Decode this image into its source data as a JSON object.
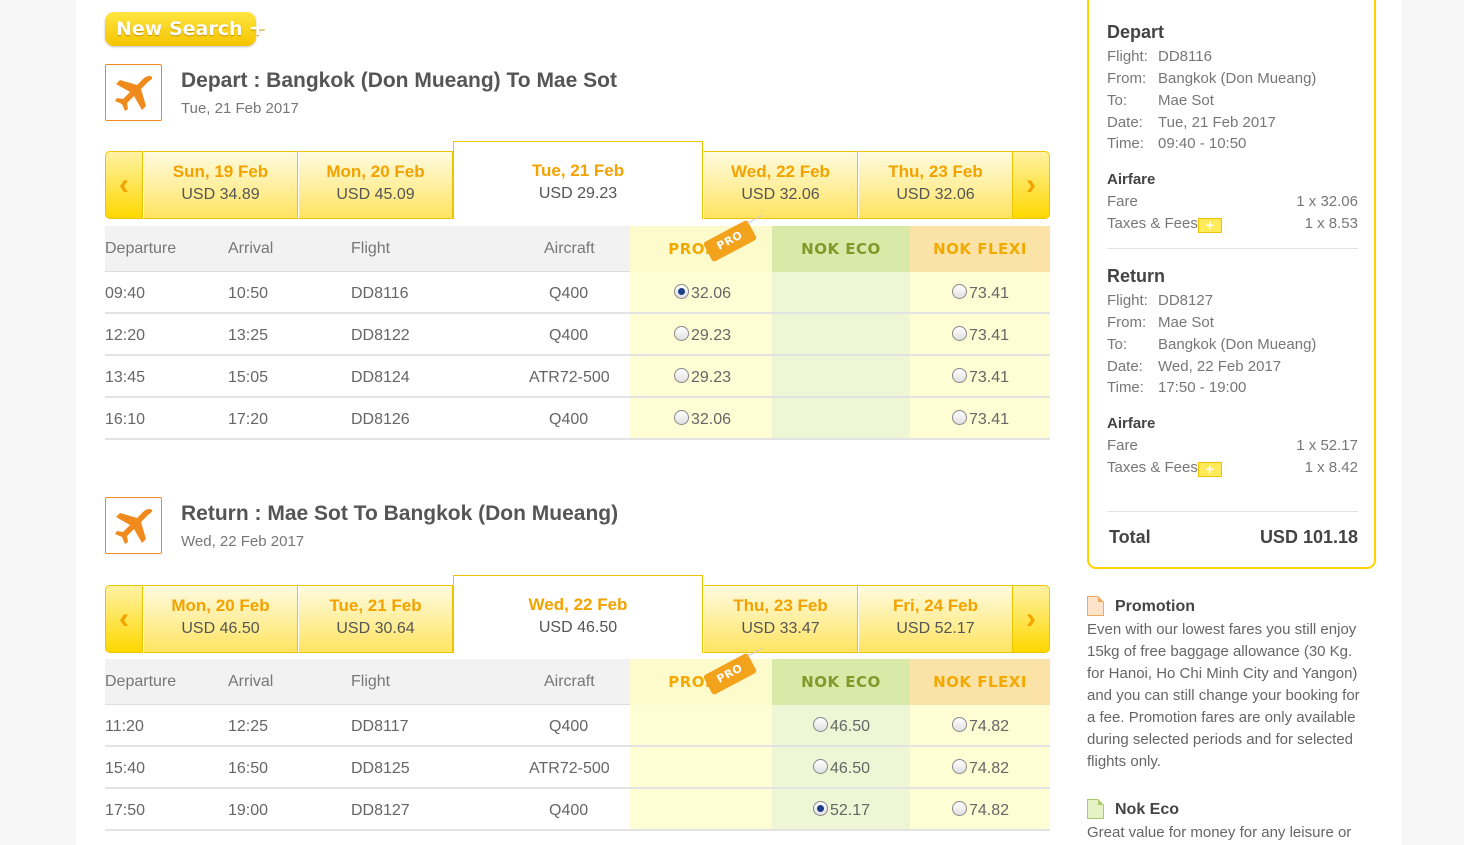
{
  "new_search": {
    "label": "New Search",
    "plus": "+"
  },
  "depart": {
    "title": "Depart :  Bangkok (Don Mueang)  To  Mae Sot",
    "date": "Tue, 21 Feb 2017",
    "dates": [
      {
        "day": "Sun, 19 Feb",
        "price": "USD  34.89"
      },
      {
        "day": "Mon, 20 Feb",
        "price": "USD  45.09"
      },
      {
        "day": "Tue, 21 Feb",
        "price": "USD  29.23"
      },
      {
        "day": "Wed, 22 Feb",
        "price": "USD  32.06"
      },
      {
        "day": "Thu, 23 Feb",
        "price": "USD  32.06"
      }
    ],
    "flights": [
      {
        "dep": "09:40",
        "arr": "10:50",
        "flight": "DD8116",
        "aircraft": "Q400",
        "promo": "32.06",
        "eco": "",
        "flexi": "73.41"
      },
      {
        "dep": "12:20",
        "arr": "13:25",
        "flight": "DD8122",
        "aircraft": "Q400",
        "promo": "29.23",
        "eco": "",
        "flexi": "73.41"
      },
      {
        "dep": "13:45",
        "arr": "15:05",
        "flight": "DD8124",
        "aircraft": "ATR72-500",
        "promo": "29.23",
        "eco": "",
        "flexi": "73.41"
      },
      {
        "dep": "16:10",
        "arr": "17:20",
        "flight": "DD8126",
        "aircraft": "Q400",
        "promo": "32.06",
        "eco": "",
        "flexi": "73.41"
      }
    ]
  },
  "return": {
    "title": "Return :  Mae Sot  To  Bangkok (Don Mueang)",
    "date": "Wed, 22 Feb 2017",
    "dates": [
      {
        "day": "Mon, 20 Feb",
        "price": "USD  46.50"
      },
      {
        "day": "Tue, 21 Feb",
        "price": "USD  30.64"
      },
      {
        "day": "Wed, 22 Feb",
        "price": "USD  46.50"
      },
      {
        "day": "Thu, 23 Feb",
        "price": "USD  33.47"
      },
      {
        "day": "Fri, 24 Feb",
        "price": "USD  52.17"
      }
    ],
    "flights": [
      {
        "dep": "11:20",
        "arr": "12:25",
        "flight": "DD8117",
        "aircraft": "Q400",
        "promo": "",
        "eco": "46.50",
        "flexi": "74.82"
      },
      {
        "dep": "15:40",
        "arr": "16:50",
        "flight": "DD8125",
        "aircraft": "ATR72-500",
        "promo": "",
        "eco": "46.50",
        "flexi": "74.82"
      },
      {
        "dep": "17:50",
        "arr": "19:00",
        "flight": "DD8127",
        "aircraft": "Q400",
        "promo": "",
        "eco": "52.17",
        "flexi": "74.82"
      }
    ]
  },
  "columns": {
    "departure": "Departure",
    "arrival": "Arrival",
    "flight": "Flight",
    "aircraft": "Aircraft",
    "promo": "PROMO",
    "promo_tag": "PRO",
    "eco": "NOK ECO",
    "flexi": "NOK FLEXI"
  },
  "arrows": {
    "left": "‹",
    "right": "›"
  },
  "summary": {
    "depart": {
      "heading": "Depart",
      "flight_k": "Flight:",
      "flight": "DD8116",
      "from_k": "From:",
      "from": "Bangkok (Don Mueang)",
      "to_k": "To:",
      "to": "Mae Sot",
      "date_k": "Date:",
      "date": "Tue, 21 Feb 2017",
      "time_k": "Time:",
      "time": "09:40 - 10:50",
      "airfare": "Airfare",
      "fare_k": "Fare",
      "fare": "1 x 32.06",
      "tax_k": "Taxes & Fees",
      "tax": "1 x 8.53",
      "plus": "+"
    },
    "return": {
      "heading": "Return",
      "flight_k": "Flight:",
      "flight": "DD8127",
      "from_k": "From:",
      "from": "Mae Sot",
      "to_k": "To:",
      "to": "Bangkok (Don Mueang)",
      "date_k": "Date:",
      "date": "Wed, 22 Feb 2017",
      "time_k": "Time:",
      "time": "17:50 - 19:00",
      "airfare": "Airfare",
      "fare_k": "Fare",
      "fare": "1 x 52.17",
      "tax_k": "Taxes & Fees",
      "tax": "1 x 8.42",
      "plus": "+"
    },
    "total_k": "Total",
    "total": "USD 101.18"
  },
  "info": {
    "promotion": {
      "title": "Promotion",
      "text": "Even with our lowest fares you still enjoy 15kg of free baggage allowance (30 Kg. for Hanoi, Ho Chi Minh City and Yangon) and you can still change your booking for a fee. Promotion fares are only available during selected periods and for selected flights only."
    },
    "eco": {
      "title": "Nok Eco",
      "text": "Great value for money for any leisure or"
    }
  },
  "colors": {
    "accent": "#ffd200",
    "orange": "#f3a200",
    "eco_green": "#7e9a2b"
  },
  "icons": {
    "plane": "plane-icon",
    "doc": "document-icon"
  }
}
